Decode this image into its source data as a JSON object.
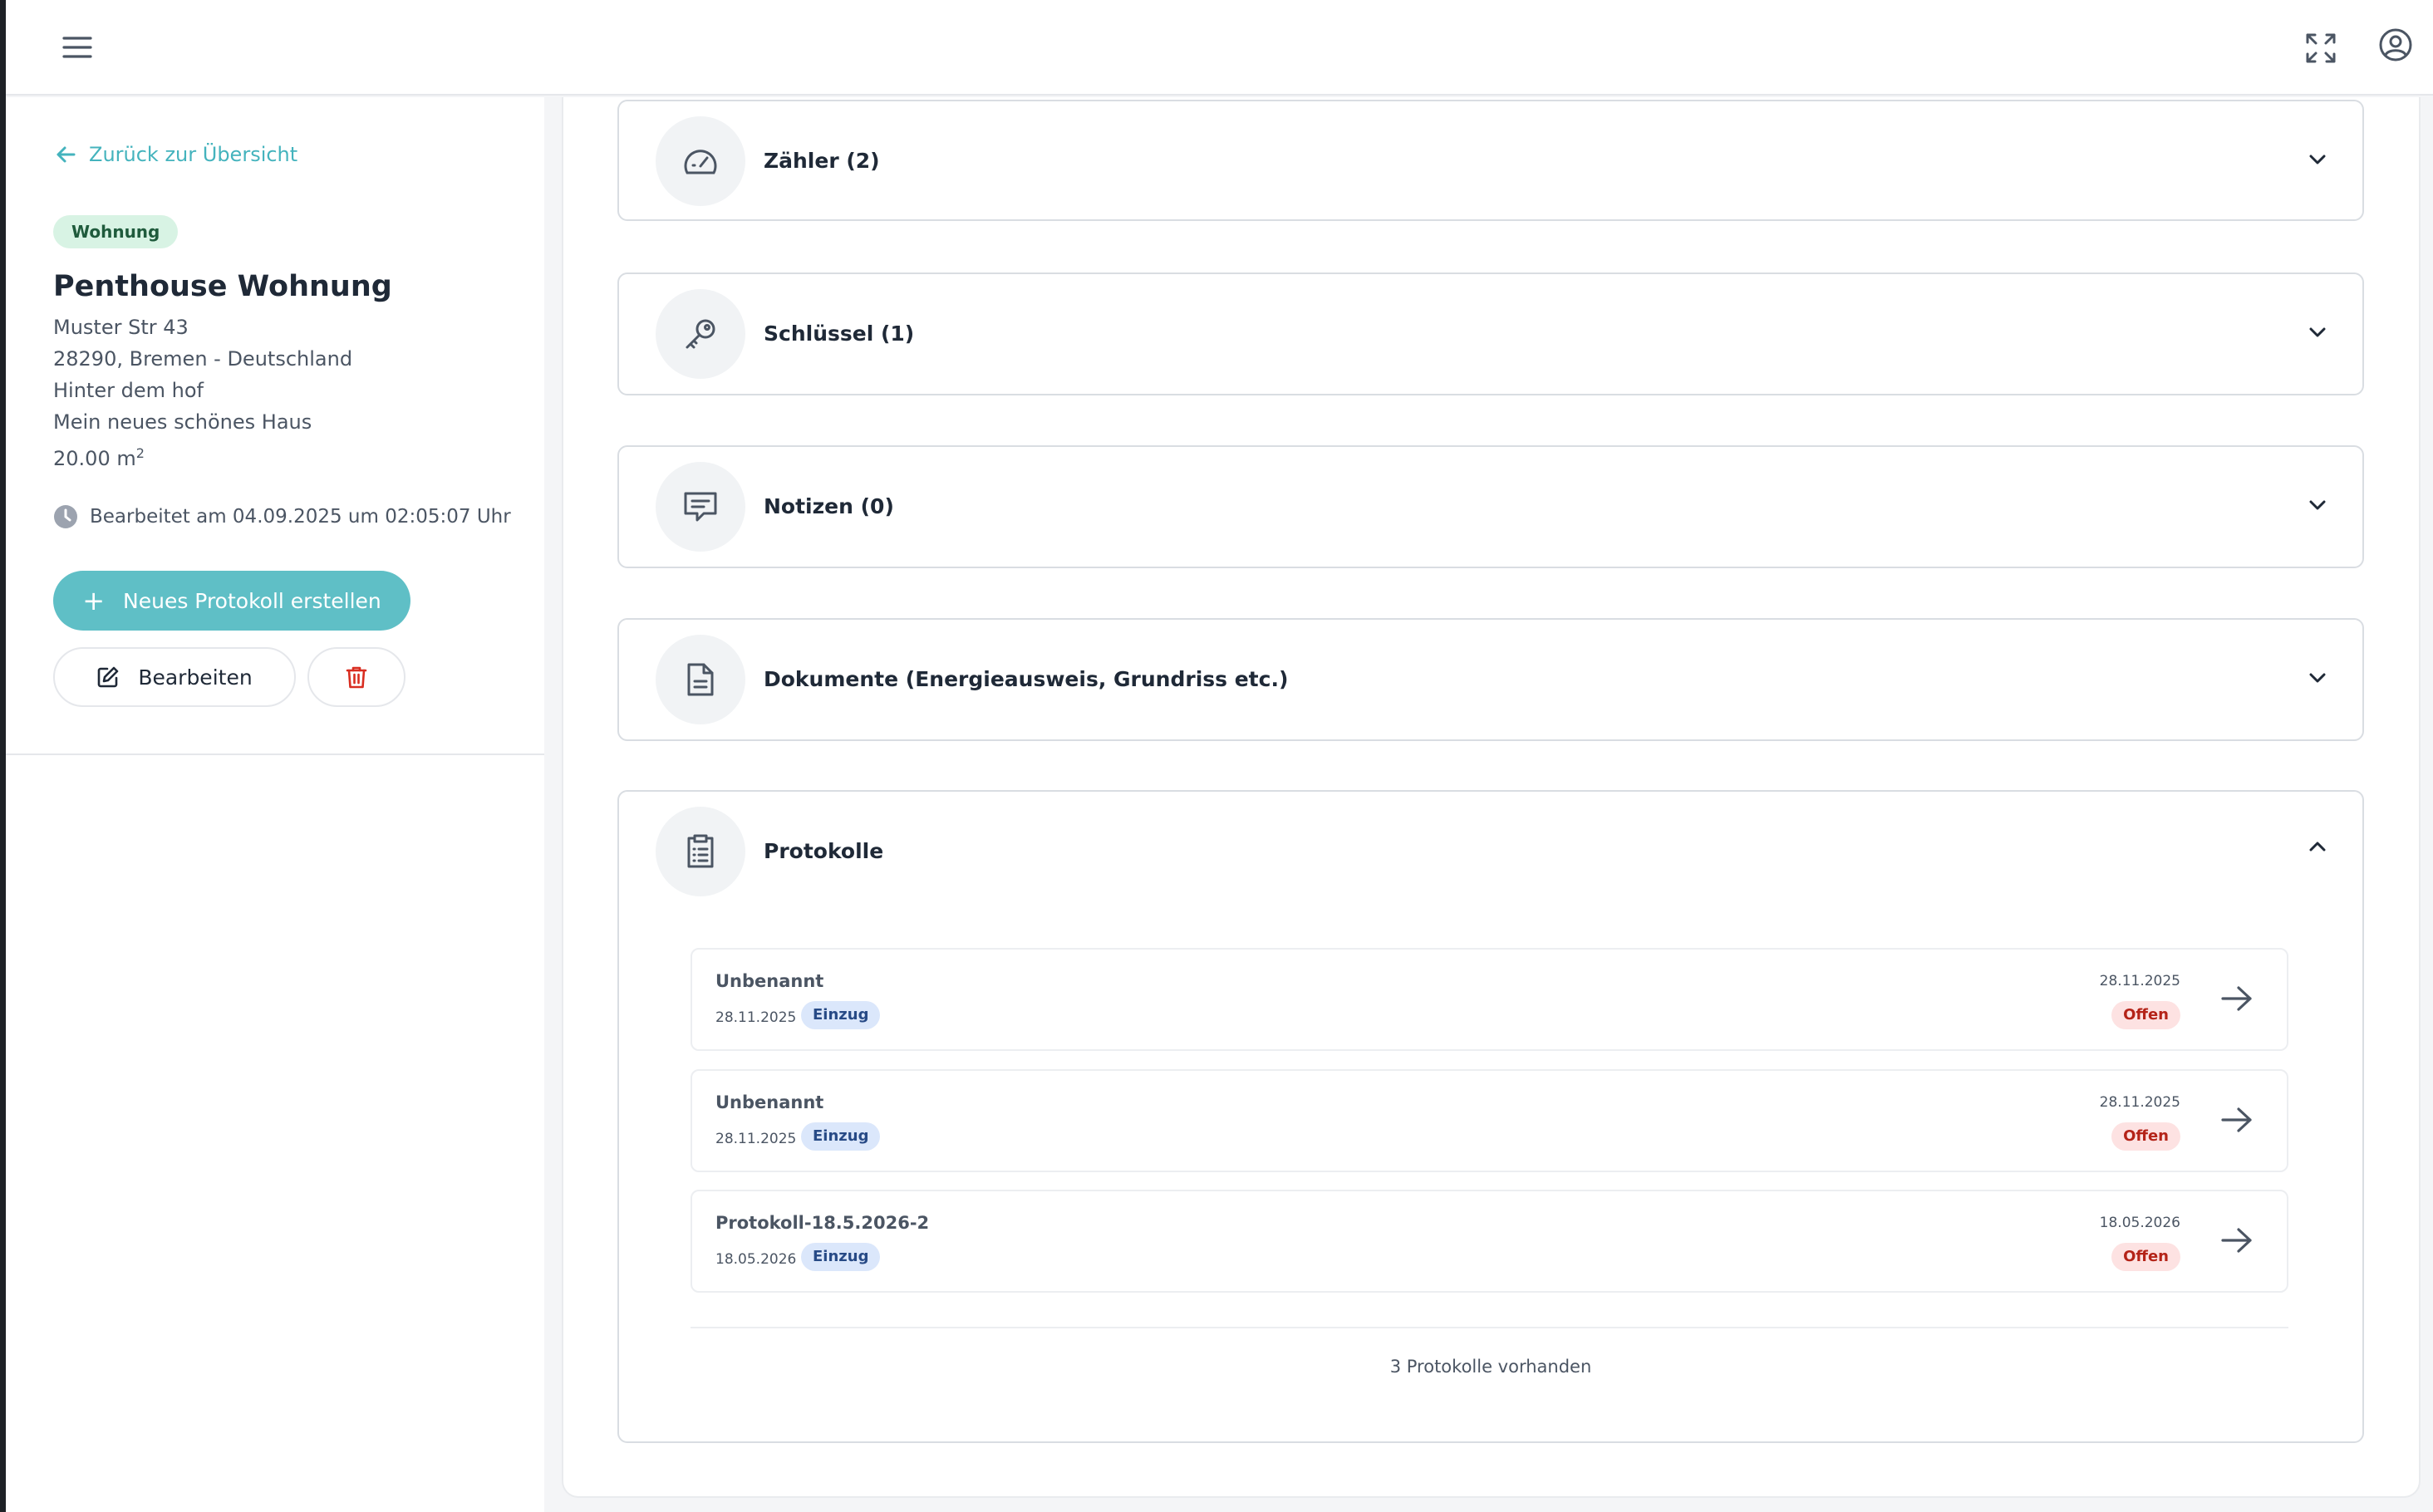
{
  "property": {
    "back_label": "Zurück zur Übersicht",
    "type_badge": "Wohnung",
    "title": "Penthouse Wohnung",
    "street": "Muster Str 43",
    "city_line": "28290, Bremen - Deutschland",
    "note_1": "Hinter dem hof",
    "note_2": "Mein neues schönes Haus",
    "area_value": "20.00 m",
    "area_exp": "2",
    "edited_label": "Bearbeitet am 04.09.2025 um 02:05:07 Uhr"
  },
  "actions": {
    "new_protocol": "Neues Protokoll erstellen",
    "edit": "Bearbeiten"
  },
  "sections": [
    {
      "label": "Zähler (2)",
      "icon": "gauge-icon",
      "expanded": false
    },
    {
      "label": "Schlüssel (1)",
      "icon": "key-icon",
      "expanded": false
    },
    {
      "label": "Notizen (0)",
      "icon": "message-icon",
      "expanded": false
    },
    {
      "label": "Dokumente (Energieausweis, Grundriss etc.)",
      "icon": "document-icon",
      "expanded": false
    },
    {
      "label": "Protokolle",
      "icon": "clipboard-list-icon",
      "expanded": true
    }
  ],
  "protocols": [
    {
      "name": "Unbenannt",
      "date": "28.11.2025",
      "type": "Einzug",
      "right_date": "28.11.2025",
      "status": "Offen"
    },
    {
      "name": "Unbenannt",
      "date": "28.11.2025",
      "type": "Einzug",
      "right_date": "28.11.2025",
      "status": "Offen"
    },
    {
      "name": "Protokoll-18.5.2026-2",
      "date": "18.05.2026",
      "type": "Einzug",
      "right_date": "18.05.2026",
      "status": "Offen"
    }
  ],
  "protocols_count": "3 Protokolle vorhanden",
  "colors": {
    "accent": "#5fbfc6",
    "link": "#44b3bd",
    "delete": "#d92d20",
    "status_open_bg": "#fde2e2",
    "type_badge_bg": "#d8f3e4"
  }
}
